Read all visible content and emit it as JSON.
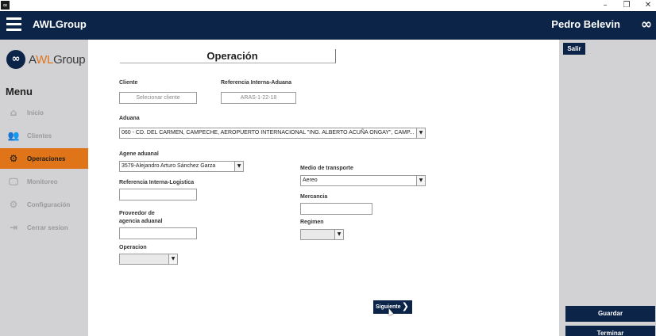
{
  "window": {
    "app_icon": "∞",
    "minimize": "–",
    "restore": "❐",
    "close": "✕"
  },
  "header": {
    "app_title": "AWLGroup",
    "user_name": "Pedro Belevin",
    "logo_symbol": "∞"
  },
  "sidebar": {
    "logo_symbol": "∞",
    "logo_text_a": "A",
    "logo_text_wl": "WL",
    "logo_text_group": "Group",
    "menu_title": "Menu",
    "items": [
      {
        "label": "Inicio",
        "icon": "home-icon",
        "glyph": "⌂"
      },
      {
        "label": "Clientes",
        "icon": "users-icon",
        "glyph": "👥"
      },
      {
        "label": "Operaciones",
        "icon": "operations-icon",
        "glyph": "⚙"
      },
      {
        "label": "Monitoreo",
        "icon": "monitor-icon",
        "glyph": "🖵"
      },
      {
        "label": "Configuración",
        "icon": "settings-icon",
        "glyph": "⚙"
      },
      {
        "label": "Cerrar sesion",
        "icon": "logout-icon",
        "glyph": "⇥"
      }
    ],
    "active_item": "Operaciones"
  },
  "right_panel": {
    "salir": "Salir",
    "guardar": "Guardar",
    "terminar": "Terminar"
  },
  "form": {
    "title": "Operación",
    "cliente": {
      "label": "Cliente",
      "placeholder": "Selecionar cliente"
    },
    "referencia_aduana": {
      "label": "Referencia Interna-Aduana",
      "value": "ARAS-1-22-18"
    },
    "aduana": {
      "label": "Aduana",
      "value": "060 - CD. DEL CARMEN, CAMPECHE, AEROPUERTO INTERNACIONAL \"ING. ALBERTO ACUÑA ONGAY\", CAMP..."
    },
    "agente_aduanal": {
      "label": "Agene aduanal",
      "value": "3579-Alejandro Arturo Sánchez Garza"
    },
    "referencia_logistica": {
      "label": "Referencia Interna-Logistica",
      "value": ""
    },
    "proveedor": {
      "label_line1": "Proveedor de",
      "label_line2": "agencia aduanal",
      "value": ""
    },
    "operacion": {
      "label": "Operacion",
      "value": ""
    },
    "medio_transporte": {
      "label": "Medio de transporte",
      "value": "Aereo"
    },
    "mercancia": {
      "label": "Mercancia",
      "value": ""
    },
    "regimen": {
      "label": "Regimen",
      "value": ""
    },
    "siguiente": "Siguiente",
    "siguiente_chevron": "❯",
    "dropdown_arrow": "▼"
  },
  "colors": {
    "navy": "#0b2447",
    "accent_orange": "#e07418",
    "sidebar_gray": "#d2d2d4"
  }
}
